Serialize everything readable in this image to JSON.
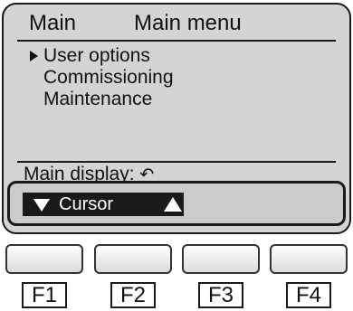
{
  "screen": {
    "title": "Main",
    "subtitle": "Main menu",
    "menu": [
      {
        "label": "User options",
        "selected": true
      },
      {
        "label": "Commissioning",
        "selected": false
      },
      {
        "label": "Maintenance",
        "selected": false
      }
    ],
    "footer": {
      "main_display_label": "Main display:",
      "return_icon": "return-arrow-icon"
    },
    "cursor_bar": {
      "label": "Cursor",
      "down_icon": "triangle-down-icon",
      "up_icon": "triangle-up-icon"
    }
  },
  "function_keys": [
    {
      "label": "F1"
    },
    {
      "label": "F2"
    },
    {
      "label": "F3"
    },
    {
      "label": "F4"
    }
  ]
}
